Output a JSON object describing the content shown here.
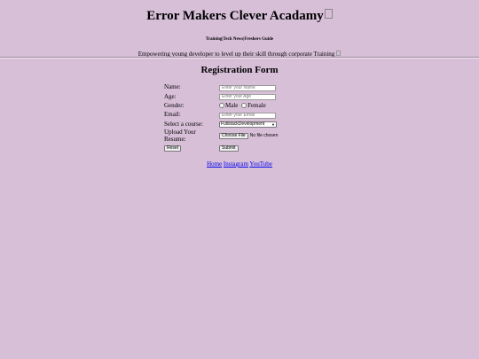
{
  "header": {
    "title": "Error Makers Clever Acadamy",
    "nav_links": "Training|Tech News|Freshers Guide",
    "tagline": "Empowering young developer to level up their skill through corporate Training"
  },
  "form": {
    "title": "Registration Form",
    "name": {
      "label": "Name:",
      "placeholder": "Enter your Name"
    },
    "age": {
      "label": "Age:",
      "placeholder": "Enter your Age"
    },
    "gender": {
      "label": "Gender:",
      "options": [
        "Male",
        "Female"
      ]
    },
    "email": {
      "label": "Email:",
      "placeholder": "Enter your Email"
    },
    "course": {
      "label": "Select a course:",
      "selected": "FullstackDevelopment"
    },
    "resume": {
      "label": "Upload Your Resume:",
      "button": "Choose File",
      "status": "No file chosen"
    },
    "reset_label": "Reset",
    "submit_label": "Submit"
  },
  "footer": {
    "links": [
      "Home",
      "Instagram",
      "YouTube"
    ]
  },
  "colors": {
    "background": "#d8bfd8",
    "link": "#0000ee"
  }
}
